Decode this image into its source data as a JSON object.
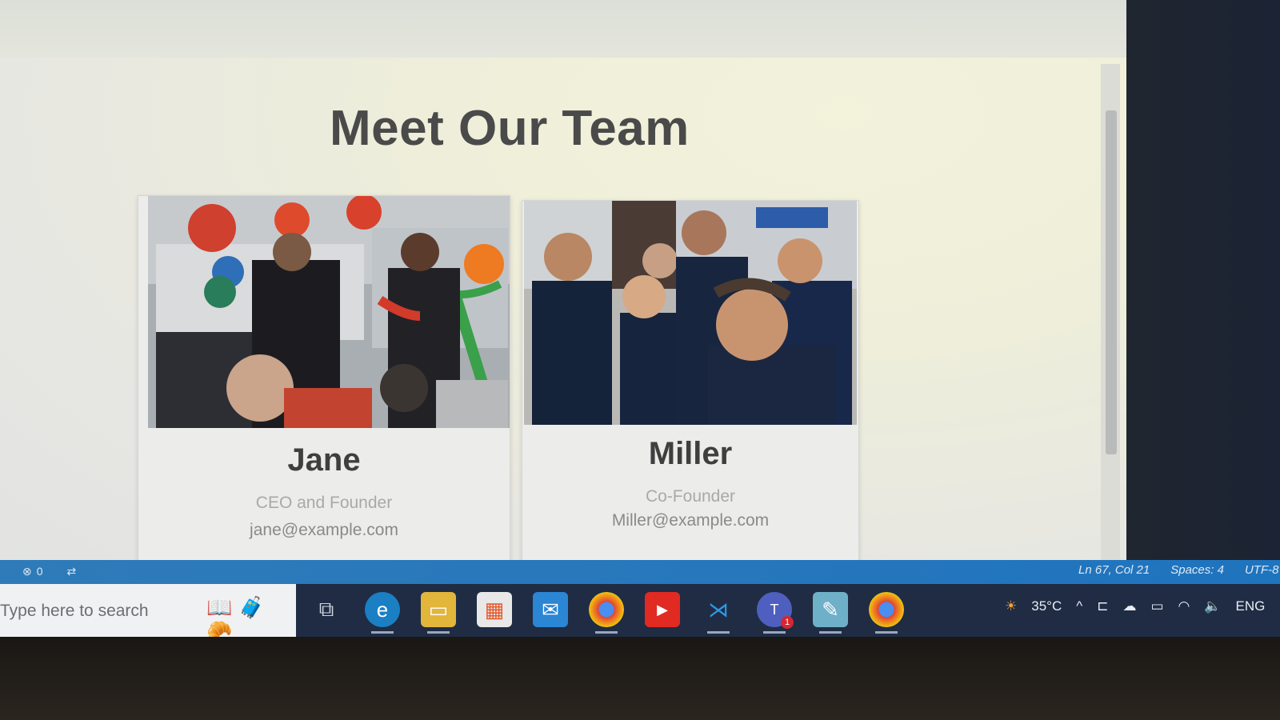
{
  "page": {
    "title": "Meet Our Team"
  },
  "team": [
    {
      "name": "Jane",
      "role": "CEO and Founder",
      "email": "jane@example.com"
    },
    {
      "name": "Miller",
      "role": "Co-Founder",
      "email": "Miller@example.com"
    }
  ],
  "statusbar": {
    "problems_count": "0",
    "position": "Ln 67, Col 21",
    "spaces": "Spaces: 4",
    "encoding": "UTF-8"
  },
  "taskbar": {
    "search_placeholder": "Type here to search",
    "apps": [
      "task-view",
      "edge",
      "file-explorer",
      "microsoft-store",
      "mail",
      "chrome",
      "youtube",
      "vscode",
      "teams",
      "notepad",
      "chrome"
    ],
    "teams_badge": "1",
    "weather": "35°C",
    "language": "ENG"
  },
  "colors": {
    "statusbar": "#1f74be",
    "taskbar": "#1f2c44",
    "title_text": "#4a4a4a"
  }
}
